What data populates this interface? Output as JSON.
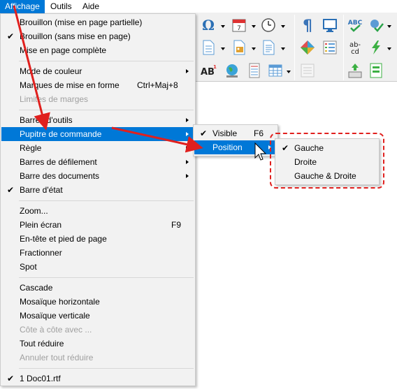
{
  "menubar": {
    "items": [
      "Affichage",
      "Outils",
      "Aide"
    ]
  },
  "main_menu": {
    "items": [
      {
        "label": "Brouillon (mise en page partielle)",
        "checked": false,
        "disabled": false
      },
      {
        "label": "Brouillon (sans mise en page)",
        "checked": true,
        "disabled": false
      },
      {
        "label": "Mise en page complète",
        "checked": false,
        "disabled": false
      },
      {
        "label": "Mode de couleur",
        "submenu": true
      },
      {
        "label": "Marques de mise en forme",
        "shortcut": "Ctrl+Maj+8"
      },
      {
        "label": "Limites de marges",
        "disabled": true
      },
      {
        "label": "Barres d'outils",
        "submenu": true
      },
      {
        "label": "Pupitre de commande",
        "submenu": true,
        "highlighted": true
      },
      {
        "label": "Règle",
        "submenu": true
      },
      {
        "label": "Barres de défilement",
        "submenu": true
      },
      {
        "label": "Barre des documents",
        "submenu": true
      },
      {
        "label": "Barre d'état",
        "checked": true
      },
      {
        "label": "Zoom..."
      },
      {
        "label": "Plein écran",
        "shortcut": "F9"
      },
      {
        "label": "En-tête et pied de page"
      },
      {
        "label": "Fractionner"
      },
      {
        "label": "Spot"
      },
      {
        "label": "Cascade"
      },
      {
        "label": "Mosaïque horizontale"
      },
      {
        "label": "Mosaïque verticale"
      },
      {
        "label": "Côte à côte avec ...",
        "disabled": true
      },
      {
        "label": "Tout réduire"
      },
      {
        "label": "Annuler tout réduire",
        "disabled": true
      },
      {
        "label": "1 Doc01.rtf",
        "checked": true
      }
    ]
  },
  "sub_menu": {
    "items": [
      {
        "label": "Visible",
        "checked": true,
        "shortcut": "F6"
      },
      {
        "label": "Position",
        "submenu": true,
        "highlighted": true
      }
    ]
  },
  "position_menu": {
    "items": [
      {
        "label": "Gauche",
        "checked": true
      },
      {
        "label": "Droite"
      },
      {
        "label": "Gauche & Droite"
      }
    ]
  },
  "glyphs": {
    "check": "✔"
  },
  "colors": {
    "accent": "#0078d7",
    "annotation": "#e0201e",
    "menu_bg": "#f2f2f2"
  },
  "icons": [
    "omega-icon",
    "calendar-icon",
    "clock-icon",
    "pilcrow-icon",
    "fullscreen-icon",
    "spellcheck-icon",
    "wrench-check-icon",
    "document-icon",
    "picture-icon",
    "text-document-icon",
    "styles-icon",
    "list-icon",
    "hyphenation-icon",
    "lightning-icon",
    "font-size-icon",
    "globe-icon",
    "page-break-icon",
    "table-icon",
    "disabled-list-icon",
    "keyboard-icon",
    "form-icon"
  ]
}
